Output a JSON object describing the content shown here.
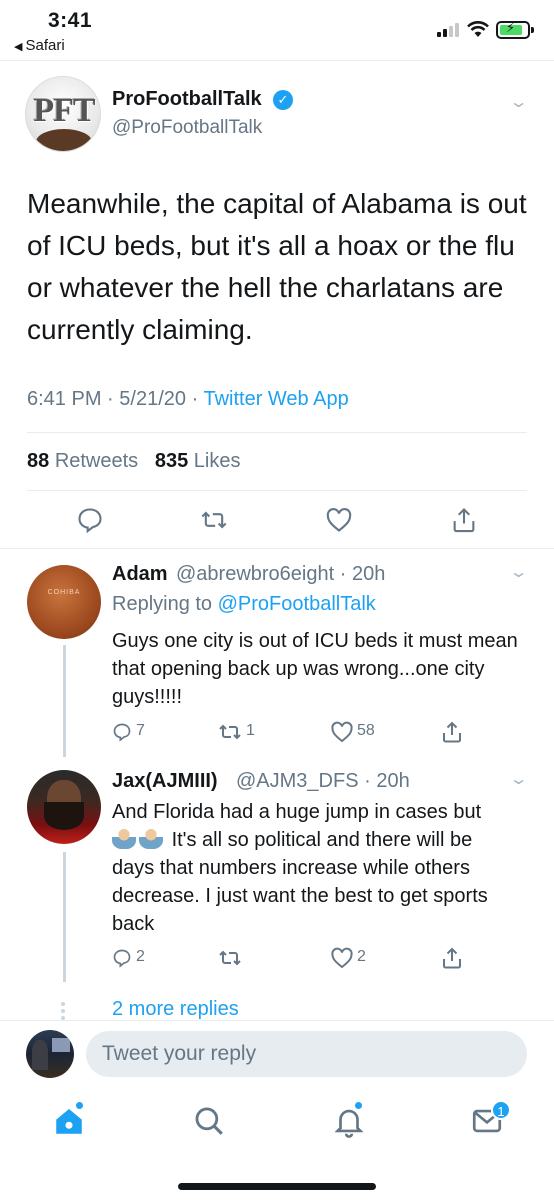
{
  "status_bar": {
    "time": "3:41",
    "back_app": "Safari"
  },
  "tweet": {
    "name": "ProFootballTalk",
    "handle": "@ProFootballTalk",
    "avatar_text": "PFT",
    "text": "Meanwhile, the capital of Alabama is out of ICU beds, but it's all a hoax or the flu or whatever the hell the charlatans are currently claiming.",
    "time": "6:41 PM",
    "date": "5/21/20",
    "separator": "·",
    "source": "Twitter Web App",
    "retweets": "88",
    "retweets_label": "Retweets",
    "likes": "835",
    "likes_label": "Likes"
  },
  "replies": [
    {
      "name": "Adam",
      "handle": "@abrewbro6eight",
      "time": "20h",
      "avatar_text": "COHIBA",
      "replying_to_label": "Replying to",
      "replying_to_handle": "@ProFootballTalk",
      "text": "Guys one city is out of ICU beds it must mean that opening back up was wrong...one city guys!!!!!",
      "reply_count": "7",
      "retweet_count": "1",
      "like_count": "58"
    },
    {
      "name": "Jax(AJMIII)",
      "handle": "@AJM3_DFS",
      "time": "20h",
      "text_line1": "And Florida had a huge jump in cases but",
      "text_line2": "It's all so political and there will be",
      "text_rest": "days that numbers increase while others decrease. I just want the best to get sports back",
      "reply_count": "2",
      "retweet_count": "",
      "like_count": "2"
    }
  ],
  "more_replies": "2 more replies",
  "composer": {
    "placeholder": "Tweet your reply"
  },
  "tabbar": {
    "messages_badge": "1"
  },
  "colors": {
    "accent": "#1da1f2",
    "secondary_text": "#657786",
    "divider": "#e6ecf0"
  }
}
